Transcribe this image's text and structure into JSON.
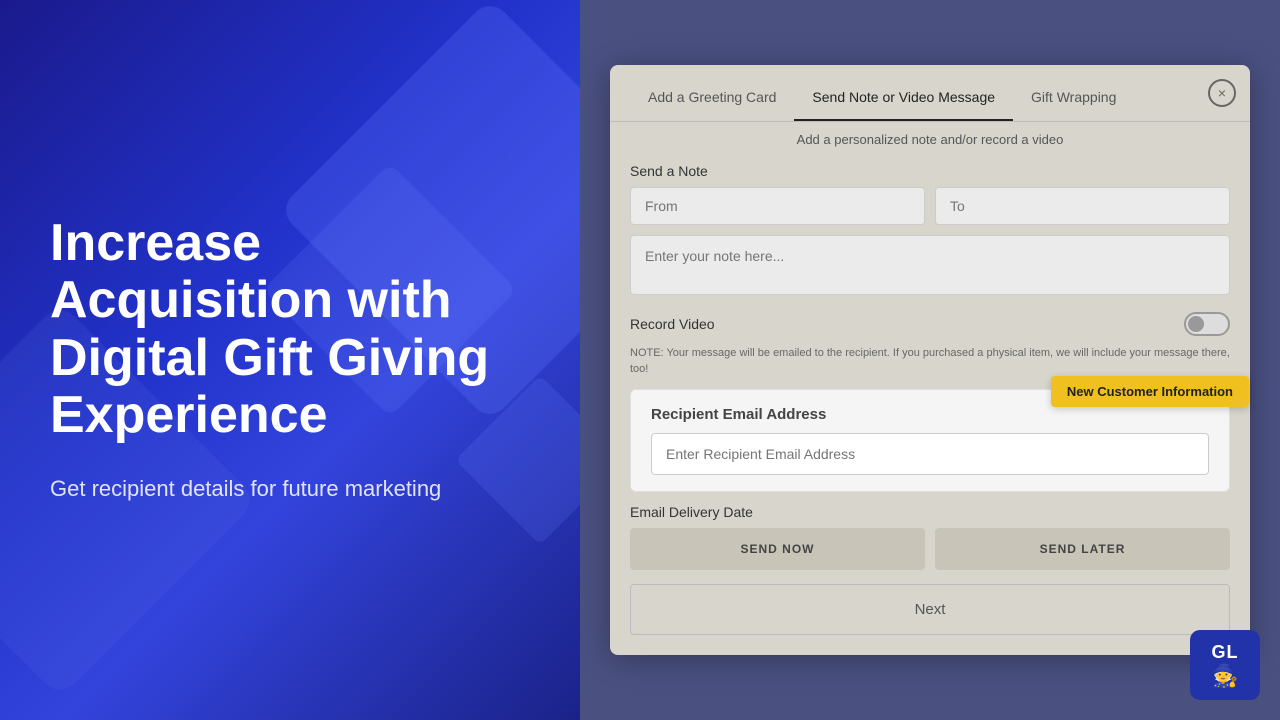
{
  "left": {
    "heading": "Increase Acquisition with Digital Gift Giving Experience",
    "subtext": "Get recipient details for future marketing"
  },
  "modal": {
    "close_icon": "×",
    "tabs": [
      {
        "label": "Add a Greeting Card",
        "active": false
      },
      {
        "label": "Send Note or Video Message",
        "active": true
      },
      {
        "label": "Gift Wrapping",
        "active": false
      }
    ],
    "subtitle": "Add a personalized note and/or record a video",
    "send_note_label": "Send a Note",
    "from_placeholder": "From",
    "to_placeholder": "To",
    "note_placeholder": "Enter your note here...",
    "record_video_label": "Record Video",
    "note_disclaimer": "NOTE: Your message will be emailed to the recipient. If you purchased a physical item, we will include your message there, too!",
    "recipient_section": {
      "label": "Recipient Email Address",
      "input_placeholder": "Enter Recipient Email Address"
    },
    "new_customer_badge": "New Customer Information",
    "email_delivery_label": "Email Delivery Date",
    "send_now_label": "SEND NOW",
    "send_later_label": "SEND LATER",
    "next_label": "Next"
  },
  "logo": {
    "letters": "GL",
    "icon": "🧙"
  }
}
